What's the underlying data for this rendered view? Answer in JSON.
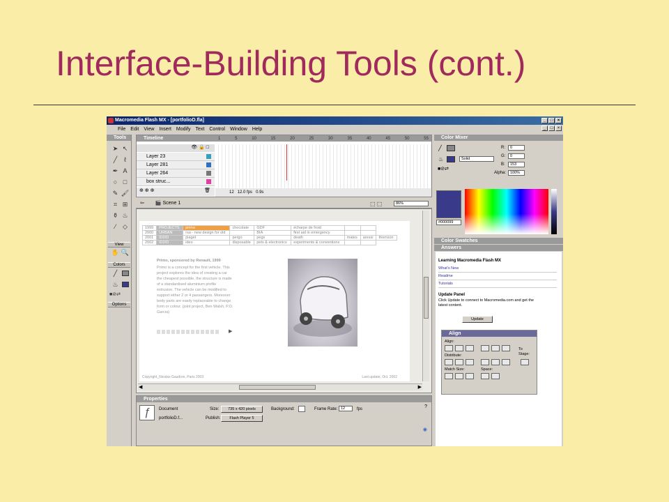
{
  "slide": {
    "title": "Interface-Building Tools (cont.)"
  },
  "window": {
    "title": "Macromedia Flash MX - [portfolioD.fla]",
    "menus": [
      "File",
      "Edit",
      "View",
      "Insert",
      "Modify",
      "Text",
      "Control",
      "Window",
      "Help"
    ]
  },
  "tools": {
    "header": "Tools",
    "view_label": "View",
    "colors_label": "Colors",
    "options_label": "Options"
  },
  "timeline": {
    "header": "Timeline",
    "layers": [
      "Layer 23",
      "Layer 281",
      "Layer 264",
      "box struc..."
    ],
    "frame_numbers": [
      "1",
      "5",
      "10",
      "15",
      "20",
      "25",
      "30",
      "35",
      "40",
      "45",
      "50",
      "55"
    ],
    "status": {
      "frame": "12",
      "fps": "12.0 fps",
      "time": "0.9s"
    }
  },
  "scene": {
    "label": "Scene 1",
    "zoom": "86%"
  },
  "stage": {
    "table": [
      [
        "1999",
        "PROJECTS",
        "primo",
        "chocolate",
        "GDF",
        "écharpe de froid",
        "",
        ""
      ],
      [
        "2000",
        "URBAN",
        "rsa - new design for old",
        "",
        "BIA",
        "first aid in emergency",
        "",
        ""
      ],
      [
        "2001",
        "ID2/D",
        "piaget",
        "pergo",
        "pegs",
        "death",
        "mates",
        "aressi",
        "thomson"
      ],
      [
        "2002",
        "ID2/D",
        "ideo",
        "disposable",
        "pets & electronics",
        "experiments & conventions",
        "",
        ""
      ]
    ],
    "desc_title": "Primo, sponsored by Renault, 1999",
    "desc_body": "Primo is a concept for the first vehicle. This project explores the idea of creating a car the cheapest possible, the structure is made of a standardised aluminium profile extrusion. The vehicle can be modified to support either 2 or 4 passengers. Moreover body parts are easily replaceable to change form or colour. (joint project, Ben Walsh, P.O. Garcia)",
    "footer_left": "Copyright_Nicolas Gaudron, Paris 2003",
    "footer_right": "Last update, Oct. 2002"
  },
  "properties": {
    "header": "Properties",
    "doc_label": "Document",
    "doc_name": "portfolioD.f...",
    "size_label": "Size:",
    "size_value": "735 x 420 pixels",
    "background_label": "Background:",
    "framerate_label": "Frame Rate:",
    "framerate_value": "12",
    "fps_label": "fps",
    "publish_label": "Publish:",
    "publish_value": "Flash Player 5"
  },
  "color_mixer": {
    "header": "Color Mixer",
    "fill_type": "Solid",
    "r_label": "R:",
    "r_value": "0",
    "g_label": "G:",
    "g_value": "0",
    "b_label": "B:",
    "b_value": "153",
    "alpha_label": "Alpha:",
    "alpha_value": "100%",
    "hex": "#000099",
    "swatch_color": "#3a3a8a"
  },
  "swatches": {
    "header": "Color Swatches"
  },
  "answers": {
    "header": "Answers",
    "title": "Learning Macromedia Flash MX",
    "links": [
      "What's New",
      "Readme",
      "Tutorials"
    ],
    "update_title": "Update Panel",
    "update_text": "Click Update to connect to Macromedia.com and get the latest content.",
    "update_button": "Update"
  },
  "align": {
    "header": "Align",
    "align_label": "Align:",
    "distribute_label": "Distribute:",
    "match_label": "Match Size:",
    "space_label": "Space:",
    "to_stage_label": "To Stage:"
  }
}
